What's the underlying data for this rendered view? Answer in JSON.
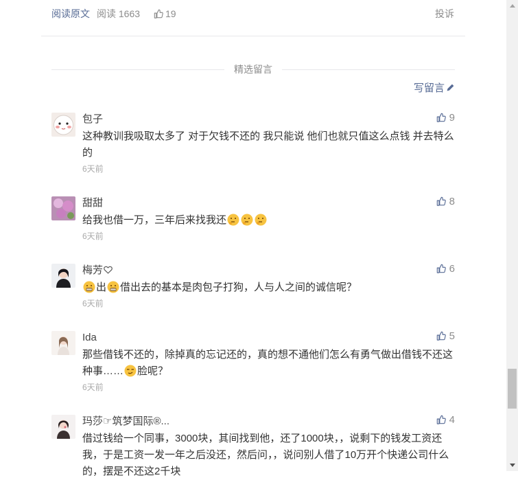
{
  "article_footer": {
    "read_original": "阅读原文",
    "reads": "阅读 1663",
    "likes": "19",
    "report": "投诉"
  },
  "selected_title": "精选留言",
  "write_comment": "写留言",
  "comments": [
    {
      "nick": "包子",
      "likes": "9",
      "text": "这种教训我吸取太多了 对于欠钱不还的 我只能说 他们也就只值这么点钱 并去特么的",
      "time": "6天前"
    },
    {
      "nick": "甜甜",
      "likes": "8",
      "text": "给我也借一万，三年后来找我还",
      "time": "6天前"
    },
    {
      "nick": "梅芳",
      "likes": "6",
      "text_a": "出",
      "text_b": "借出去的基本是肉包子打狗，人与人之间的诚信呢？",
      "time": "6天前"
    },
    {
      "nick": "Ida",
      "likes": "5",
      "text_a": "那些借钱不还的，除掉真的忘记还的，真的想不通他们怎么有勇气做出借钱不还这种事……",
      "text_b": "脸呢？",
      "time": "6天前"
    },
    {
      "nick": "玛莎☞筑梦国际®...",
      "likes": "4",
      "text": "借过钱给一个同事，3000块，其间找到他，还了1000块，，说剩下的钱发工资还我，于是工资一发一年之后没还，然后问，，说问别人借了10万开个快递公司什么的，摆是不还这2千块"
    }
  ],
  "colors": {
    "link": "#576b95",
    "muted": "#8c8c8c",
    "text": "#333333"
  }
}
